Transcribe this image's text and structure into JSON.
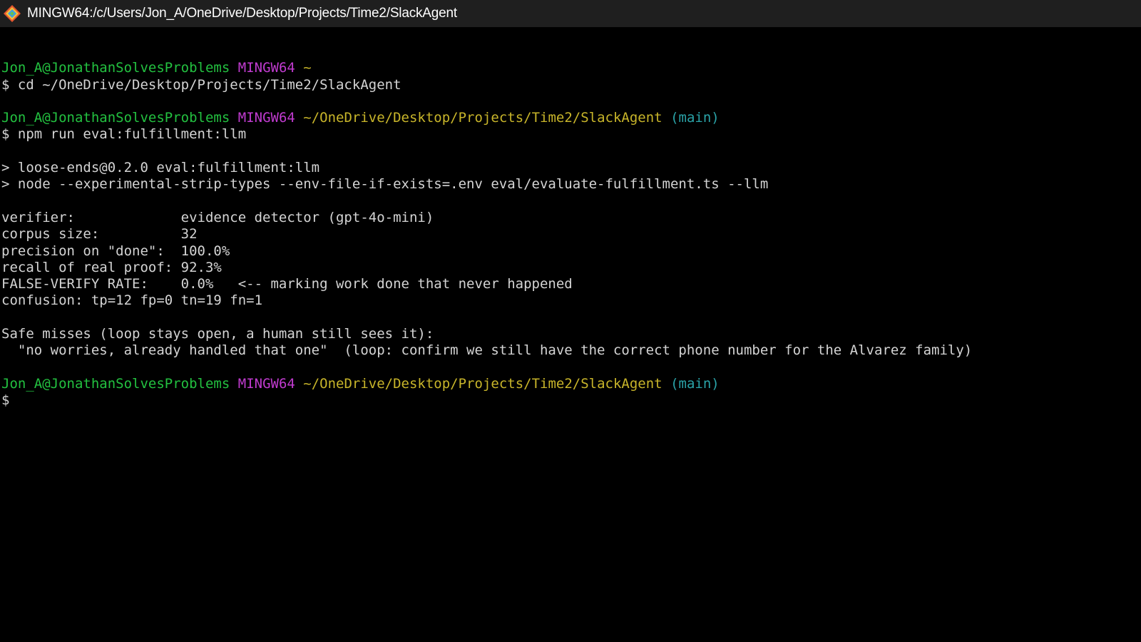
{
  "window": {
    "title": "MINGW64:/c/Users/Jon_A/OneDrive/Desktop/Projects/Time2/SlackAgent",
    "icon": "git-bash-icon"
  },
  "colors": {
    "background": "#000000",
    "titlebar": "#1f1f1f",
    "text": "#d4d4d4",
    "user_host": "#23c140",
    "mingw": "#c03bcf",
    "path": "#c8b52a",
    "branch": "#2aa3a8"
  },
  "terminal": {
    "lines": [
      {
        "segments": []
      },
      {
        "segments": [
          {
            "text": "Jon_A@JonathanSolvesProblems",
            "color": "user_host"
          },
          {
            "text": " ",
            "color": "text"
          },
          {
            "text": "MINGW64",
            "color": "mingw"
          },
          {
            "text": " ",
            "color": "text"
          },
          {
            "text": "~",
            "color": "path"
          }
        ]
      },
      {
        "segments": [
          {
            "text": "$ cd ~/OneDrive/Desktop/Projects/Time2/SlackAgent",
            "color": "text"
          }
        ]
      },
      {
        "segments": []
      },
      {
        "segments": [
          {
            "text": "Jon_A@JonathanSolvesProblems",
            "color": "user_host"
          },
          {
            "text": " ",
            "color": "text"
          },
          {
            "text": "MINGW64",
            "color": "mingw"
          },
          {
            "text": " ",
            "color": "text"
          },
          {
            "text": "~/OneDrive/Desktop/Projects/Time2/SlackAgent",
            "color": "path"
          },
          {
            "text": " ",
            "color": "text"
          },
          {
            "text": "(main)",
            "color": "branch"
          }
        ]
      },
      {
        "segments": [
          {
            "text": "$ npm run eval:fulfillment:llm",
            "color": "text"
          }
        ]
      },
      {
        "segments": []
      },
      {
        "segments": [
          {
            "text": "> loose-ends@0.2.0 eval:fulfillment:llm",
            "color": "text"
          }
        ]
      },
      {
        "segments": [
          {
            "text": "> node --experimental-strip-types --env-file-if-exists=.env eval/evaluate-fulfillment.ts --llm",
            "color": "text"
          }
        ]
      },
      {
        "segments": []
      },
      {
        "segments": [
          {
            "text": "verifier:             evidence detector (gpt-4o-mini)",
            "color": "text"
          }
        ]
      },
      {
        "segments": [
          {
            "text": "corpus size:          32",
            "color": "text"
          }
        ]
      },
      {
        "segments": [
          {
            "text": "precision on \"done\":  100.0%",
            "color": "text"
          }
        ]
      },
      {
        "segments": [
          {
            "text": "recall of real proof: 92.3%",
            "color": "text"
          }
        ]
      },
      {
        "segments": [
          {
            "text": "FALSE-VERIFY RATE:    0.0%   <-- marking work done that never happened",
            "color": "text"
          }
        ]
      },
      {
        "segments": [
          {
            "text": "confusion: tp=12 fp=0 tn=19 fn=1",
            "color": "text"
          }
        ]
      },
      {
        "segments": []
      },
      {
        "segments": [
          {
            "text": "Safe misses (loop stays open, a human still sees it):",
            "color": "text"
          }
        ]
      },
      {
        "segments": [
          {
            "text": "  \"no worries, already handled that one\"  (loop: confirm we still have the correct phone number for the Alvarez family)",
            "color": "text"
          }
        ]
      },
      {
        "segments": []
      },
      {
        "segments": [
          {
            "text": "Jon_A@JonathanSolvesProblems",
            "color": "user_host"
          },
          {
            "text": " ",
            "color": "text"
          },
          {
            "text": "MINGW64",
            "color": "mingw"
          },
          {
            "text": " ",
            "color": "text"
          },
          {
            "text": "~/OneDrive/Desktop/Projects/Time2/SlackAgent",
            "color": "path"
          },
          {
            "text": " ",
            "color": "text"
          },
          {
            "text": "(main)",
            "color": "branch"
          }
        ]
      },
      {
        "segments": [
          {
            "text": "$",
            "color": "text"
          }
        ],
        "cursor": true
      }
    ]
  }
}
